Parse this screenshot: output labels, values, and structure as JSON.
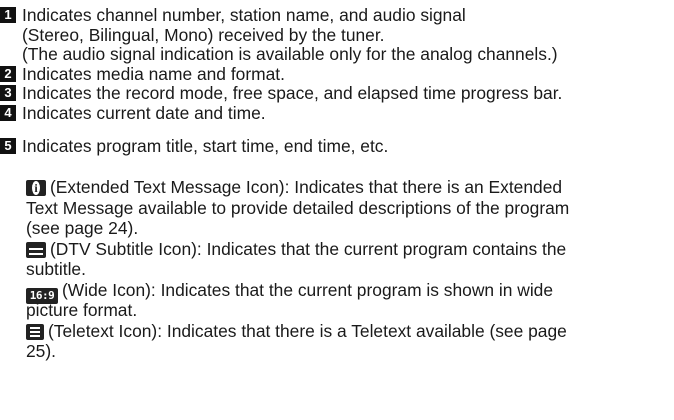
{
  "items": [
    {
      "number": "1",
      "lines": [
        "Indicates channel number, station name, and audio signal",
        "(Stereo, Bilingual, Mono) received by the tuner.",
        "(The audio signal indication is available only for the analog channels.)"
      ]
    },
    {
      "number": "2",
      "text": "Indicates media name and format."
    },
    {
      "number": "3",
      "text": "Indicates the record mode, free space, and elapsed time progress bar."
    },
    {
      "number": "4",
      "text": "Indicates current date and time."
    },
    {
      "number": "5",
      "text": "Indicates program title, start time, end time, etc."
    }
  ],
  "icons": [
    {
      "icon": "extended-text-message-icon",
      "lines": [
        "(Extended Text Message Icon): Indicates that there is an Extended",
        "Text Message available to provide detailed descriptions of the program",
        "(see page 24)."
      ]
    },
    {
      "icon": "dtv-subtitle-icon",
      "lines": [
        "(DTV Subtitle Icon): Indicates that the current program contains the",
        "subtitle."
      ]
    },
    {
      "icon": "wide-icon",
      "icon_text": "16:9",
      "lines": [
        "(Wide Icon): Indicates that the current program is shown in wide",
        "picture format."
      ]
    },
    {
      "icon": "teletext-icon",
      "lines": [
        "(Teletext Icon): Indicates that there is a Teletext available (see page",
        "25)."
      ]
    }
  ]
}
